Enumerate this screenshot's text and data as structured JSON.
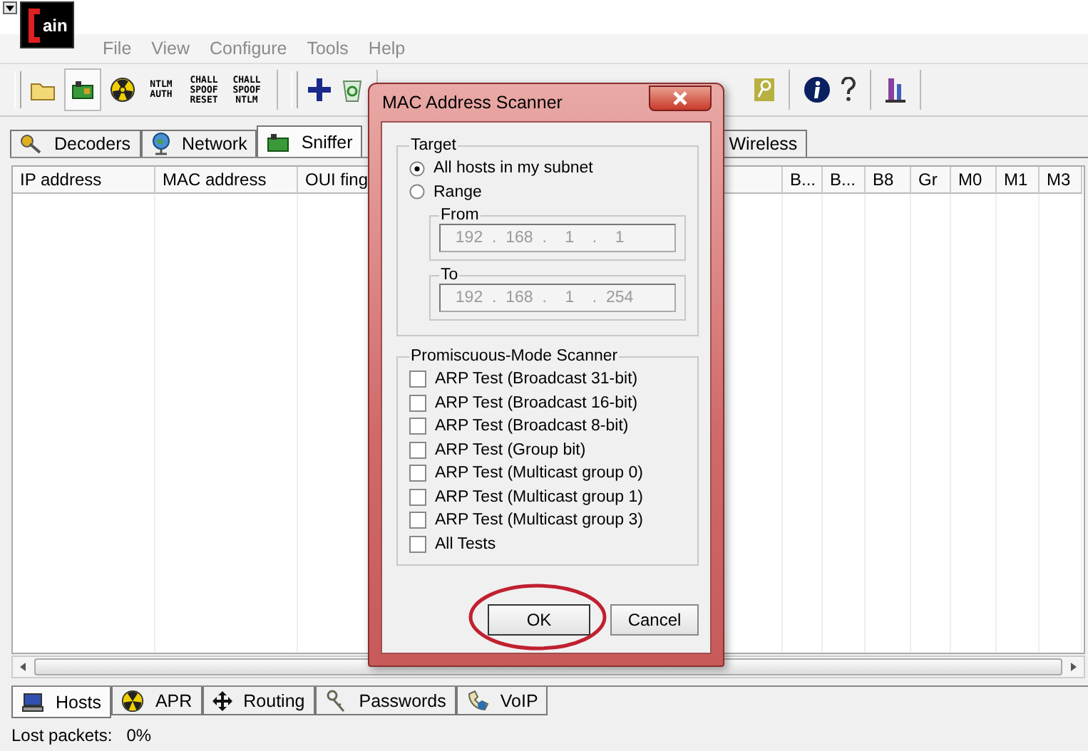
{
  "app": {
    "logo_text": "ain"
  },
  "menu": [
    "File",
    "View",
    "Configure",
    "Tools",
    "Help"
  ],
  "toolbar_labels": [
    [
      "NTLM",
      "AUTH"
    ],
    [
      "CHALL",
      "SPOOF",
      "RESET"
    ],
    [
      "CHALL",
      "SPOOF",
      "NTLM"
    ]
  ],
  "top_tabs": [
    {
      "label": "Decoders",
      "selected": false
    },
    {
      "label": "Network",
      "selected": false
    },
    {
      "label": "Sniffer",
      "selected": true
    },
    {
      "label": "Wireless",
      "selected": false
    }
  ],
  "table": {
    "columns": [
      "IP address",
      "MAC address",
      "OUI fing",
      "B...",
      "B...",
      "B8",
      "Gr",
      "M0",
      "M1",
      "M3"
    ]
  },
  "bottom_tabs": [
    {
      "label": "Hosts",
      "selected": true
    },
    {
      "label": "APR",
      "selected": false
    },
    {
      "label": "Routing",
      "selected": false
    },
    {
      "label": "Passwords",
      "selected": false
    },
    {
      "label": "VoIP",
      "selected": false
    }
  ],
  "status_bar": {
    "label": "Lost packets:",
    "value": "0%"
  },
  "dialog": {
    "title": "MAC Address Scanner",
    "target": {
      "legend": "Target",
      "radios": [
        {
          "label": "All hosts in my subnet",
          "selected": true
        },
        {
          "label": "Range",
          "selected": false
        }
      ],
      "fields": [
        {
          "legend": "From",
          "octets": [
            "192",
            "168",
            "1",
            "1"
          ],
          "separator": ".",
          "disabled": true
        },
        {
          "legend": "To",
          "octets": [
            "192",
            "168",
            "1",
            "254"
          ],
          "separator": ".",
          "disabled": true
        }
      ]
    },
    "scanner": {
      "legend": "Promiscuous-Mode Scanner",
      "checks": [
        {
          "label": "ARP Test (Broadcast 31-bit)",
          "checked": false
        },
        {
          "label": "ARP Test (Broadcast 16-bit)",
          "checked": false
        },
        {
          "label": "ARP Test (Broadcast 8-bit)",
          "checked": false
        },
        {
          "label": "ARP Test (Group bit)",
          "checked": false
        },
        {
          "label": "ARP Test (Multicast group 0)",
          "checked": false
        },
        {
          "label": "ARP Test (Multicast group 1)",
          "checked": false
        },
        {
          "label": "ARP Test (Multicast group 3)",
          "checked": false
        },
        {
          "label": "All Tests",
          "checked": false
        }
      ]
    },
    "buttons": [
      {
        "label": "OK",
        "default": true
      },
      {
        "label": "Cancel",
        "default": false
      }
    ]
  }
}
